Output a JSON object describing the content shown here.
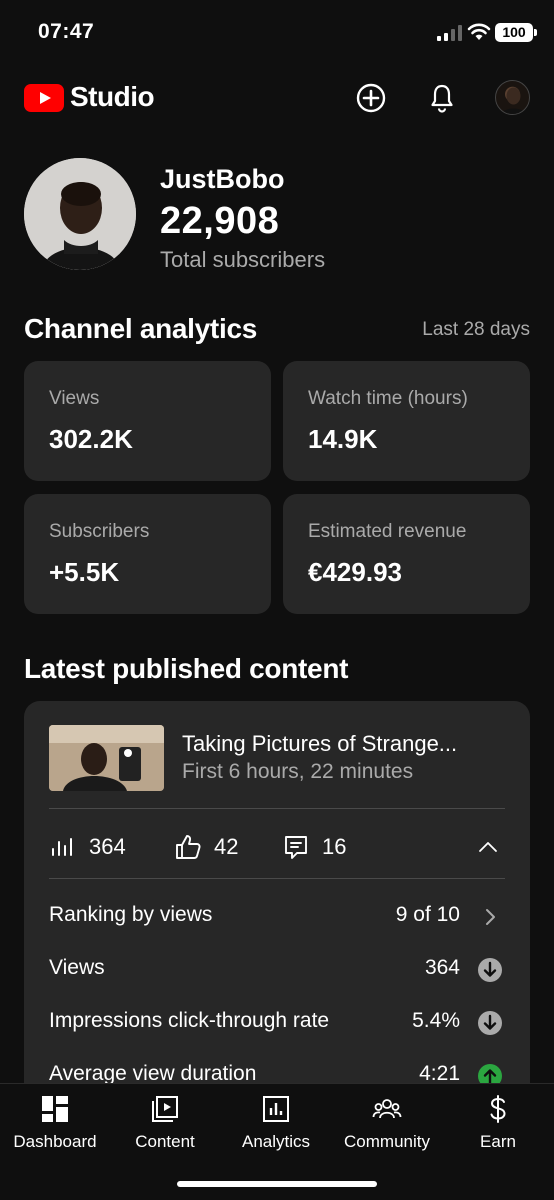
{
  "status_bar": {
    "time": "07:47",
    "battery": "100"
  },
  "header": {
    "brand": "Studio"
  },
  "channel": {
    "name": "JustBobo",
    "subscribers": "22,908",
    "subscribers_label": "Total subscribers"
  },
  "analytics": {
    "title": "Channel analytics",
    "period": "Last 28 days",
    "cards": [
      {
        "label": "Views",
        "value": "302.2K"
      },
      {
        "label": "Watch time (hours)",
        "value": "14.9K"
      },
      {
        "label": "Subscribers",
        "value": "+5.5K"
      },
      {
        "label": "Estimated revenue",
        "value": "€429.93"
      }
    ]
  },
  "latest": {
    "title": "Latest published content",
    "video_title": "Taking Pictures of Strange...",
    "video_subtitle": "First 6 hours, 22 minutes",
    "metrics": {
      "views": "364",
      "likes": "42",
      "comments": "16"
    },
    "rows": [
      {
        "label": "Ranking by views",
        "value": "9 of 10",
        "indicator": "chevron-right"
      },
      {
        "label": "Views",
        "value": "364",
        "indicator": "down"
      },
      {
        "label": "Impressions click-through rate",
        "value": "5.4%",
        "indicator": "down"
      },
      {
        "label": "Average view duration",
        "value": "4:21",
        "indicator": "up"
      }
    ]
  },
  "nav": [
    "Dashboard",
    "Content",
    "Analytics",
    "Community",
    "Earn"
  ],
  "colors": {
    "background": "#0f0f0f",
    "card": "#272727",
    "brand_red": "#ff0000",
    "secondary_text": "#aaaaaa",
    "up_green": "#2ba640",
    "down_grey": "#aaaaaa"
  }
}
